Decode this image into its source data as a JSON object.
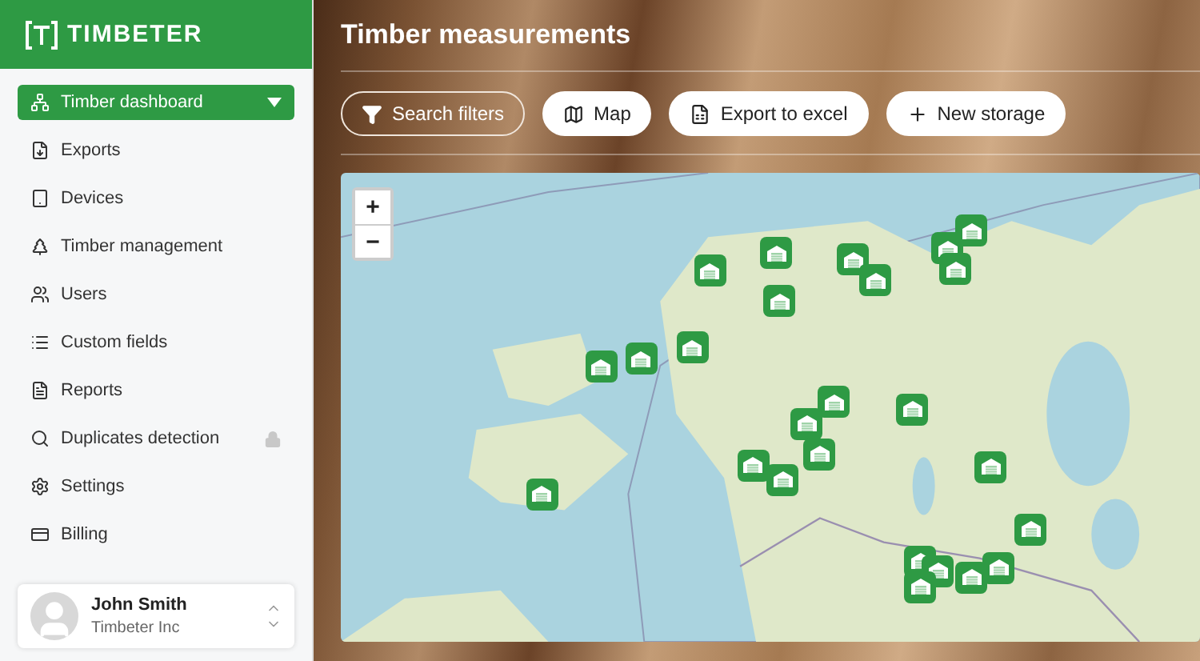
{
  "brand": {
    "name": "TIMBETER"
  },
  "sidebar": {
    "items": [
      {
        "label": "Timber dashboard",
        "selected": true,
        "locked": false
      },
      {
        "label": "Exports",
        "selected": false,
        "locked": false
      },
      {
        "label": "Devices",
        "selected": false,
        "locked": false
      },
      {
        "label": "Timber management",
        "selected": false,
        "locked": false
      },
      {
        "label": "Users",
        "selected": false,
        "locked": false
      },
      {
        "label": "Custom fields",
        "selected": false,
        "locked": false
      },
      {
        "label": "Reports",
        "selected": false,
        "locked": false
      },
      {
        "label": "Duplicates detection",
        "selected": false,
        "locked": true
      },
      {
        "label": "Settings",
        "selected": false,
        "locked": false
      },
      {
        "label": "Billing",
        "selected": false,
        "locked": false
      }
    ],
    "user": {
      "name": "John Smith",
      "company": "Timbeter Inc"
    }
  },
  "page": {
    "title": "Timber measurements"
  },
  "toolbar": [
    {
      "label": "Search filters",
      "kind": "outline"
    },
    {
      "label": "Map",
      "kind": "solid"
    },
    {
      "label": "Export to excel",
      "kind": "solid"
    },
    {
      "label": "New storage",
      "kind": "solid"
    }
  ],
  "map": {
    "zoom_controls": [
      "+",
      "−"
    ]
  }
}
